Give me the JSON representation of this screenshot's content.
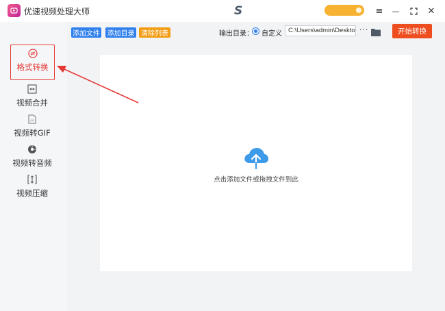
{
  "window": {
    "title": "优速视频处理大师",
    "brand_glyph": "S",
    "icons": {
      "menu": "≡",
      "minimize": "—",
      "maximize": "⛶",
      "close": "✕"
    }
  },
  "sidebar": {
    "items": [
      {
        "label": "格式转换",
        "icon": "convert-icon",
        "active": true
      },
      {
        "label": "视频合并",
        "icon": "merge-icon"
      },
      {
        "label": "视频转GIF",
        "icon": "gif-icon"
      },
      {
        "label": "视频转音频",
        "icon": "audio-icon"
      },
      {
        "label": "视频压缩",
        "icon": "compress-icon"
      }
    ]
  },
  "toolbar": {
    "add_file": "添加文件",
    "add_folder": "添加目录",
    "clear_list": "清除列表",
    "output_label": "输出目录：",
    "custom_label": "自定义",
    "output_path": "C:\\Users\\admin\\Deskto",
    "more": "···",
    "start": "开始转换"
  },
  "drop_zone": {
    "hint": "点击添加文件或拖拽文件到此"
  },
  "colors": {
    "accent_blue": "#2f80ed",
    "clear_orange": "#f39c12",
    "start_red": "#ee4d1f",
    "active_red": "#e53935",
    "cloud_blue": "#3d9bea"
  }
}
